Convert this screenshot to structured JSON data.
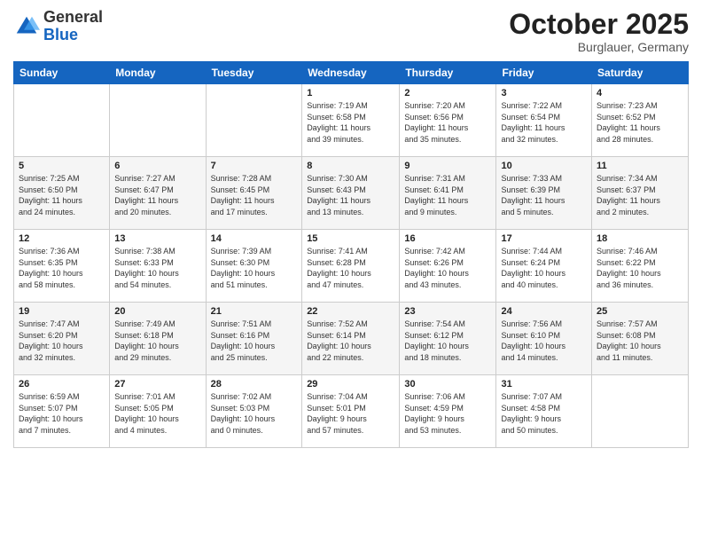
{
  "logo": {
    "general": "General",
    "blue": "Blue"
  },
  "header": {
    "month": "October 2025",
    "location": "Burglauer, Germany"
  },
  "days_of_week": [
    "Sunday",
    "Monday",
    "Tuesday",
    "Wednesday",
    "Thursday",
    "Friday",
    "Saturday"
  ],
  "weeks": [
    [
      {
        "day": "",
        "info": ""
      },
      {
        "day": "",
        "info": ""
      },
      {
        "day": "",
        "info": ""
      },
      {
        "day": "1",
        "info": "Sunrise: 7:19 AM\nSunset: 6:58 PM\nDaylight: 11 hours\nand 39 minutes."
      },
      {
        "day": "2",
        "info": "Sunrise: 7:20 AM\nSunset: 6:56 PM\nDaylight: 11 hours\nand 35 minutes."
      },
      {
        "day": "3",
        "info": "Sunrise: 7:22 AM\nSunset: 6:54 PM\nDaylight: 11 hours\nand 32 minutes."
      },
      {
        "day": "4",
        "info": "Sunrise: 7:23 AM\nSunset: 6:52 PM\nDaylight: 11 hours\nand 28 minutes."
      }
    ],
    [
      {
        "day": "5",
        "info": "Sunrise: 7:25 AM\nSunset: 6:50 PM\nDaylight: 11 hours\nand 24 minutes."
      },
      {
        "day": "6",
        "info": "Sunrise: 7:27 AM\nSunset: 6:47 PM\nDaylight: 11 hours\nand 20 minutes."
      },
      {
        "day": "7",
        "info": "Sunrise: 7:28 AM\nSunset: 6:45 PM\nDaylight: 11 hours\nand 17 minutes."
      },
      {
        "day": "8",
        "info": "Sunrise: 7:30 AM\nSunset: 6:43 PM\nDaylight: 11 hours\nand 13 minutes."
      },
      {
        "day": "9",
        "info": "Sunrise: 7:31 AM\nSunset: 6:41 PM\nDaylight: 11 hours\nand 9 minutes."
      },
      {
        "day": "10",
        "info": "Sunrise: 7:33 AM\nSunset: 6:39 PM\nDaylight: 11 hours\nand 5 minutes."
      },
      {
        "day": "11",
        "info": "Sunrise: 7:34 AM\nSunset: 6:37 PM\nDaylight: 11 hours\nand 2 minutes."
      }
    ],
    [
      {
        "day": "12",
        "info": "Sunrise: 7:36 AM\nSunset: 6:35 PM\nDaylight: 10 hours\nand 58 minutes."
      },
      {
        "day": "13",
        "info": "Sunrise: 7:38 AM\nSunset: 6:33 PM\nDaylight: 10 hours\nand 54 minutes."
      },
      {
        "day": "14",
        "info": "Sunrise: 7:39 AM\nSunset: 6:30 PM\nDaylight: 10 hours\nand 51 minutes."
      },
      {
        "day": "15",
        "info": "Sunrise: 7:41 AM\nSunset: 6:28 PM\nDaylight: 10 hours\nand 47 minutes."
      },
      {
        "day": "16",
        "info": "Sunrise: 7:42 AM\nSunset: 6:26 PM\nDaylight: 10 hours\nand 43 minutes."
      },
      {
        "day": "17",
        "info": "Sunrise: 7:44 AM\nSunset: 6:24 PM\nDaylight: 10 hours\nand 40 minutes."
      },
      {
        "day": "18",
        "info": "Sunrise: 7:46 AM\nSunset: 6:22 PM\nDaylight: 10 hours\nand 36 minutes."
      }
    ],
    [
      {
        "day": "19",
        "info": "Sunrise: 7:47 AM\nSunset: 6:20 PM\nDaylight: 10 hours\nand 32 minutes."
      },
      {
        "day": "20",
        "info": "Sunrise: 7:49 AM\nSunset: 6:18 PM\nDaylight: 10 hours\nand 29 minutes."
      },
      {
        "day": "21",
        "info": "Sunrise: 7:51 AM\nSunset: 6:16 PM\nDaylight: 10 hours\nand 25 minutes."
      },
      {
        "day": "22",
        "info": "Sunrise: 7:52 AM\nSunset: 6:14 PM\nDaylight: 10 hours\nand 22 minutes."
      },
      {
        "day": "23",
        "info": "Sunrise: 7:54 AM\nSunset: 6:12 PM\nDaylight: 10 hours\nand 18 minutes."
      },
      {
        "day": "24",
        "info": "Sunrise: 7:56 AM\nSunset: 6:10 PM\nDaylight: 10 hours\nand 14 minutes."
      },
      {
        "day": "25",
        "info": "Sunrise: 7:57 AM\nSunset: 6:08 PM\nDaylight: 10 hours\nand 11 minutes."
      }
    ],
    [
      {
        "day": "26",
        "info": "Sunrise: 6:59 AM\nSunset: 5:07 PM\nDaylight: 10 hours\nand 7 minutes."
      },
      {
        "day": "27",
        "info": "Sunrise: 7:01 AM\nSunset: 5:05 PM\nDaylight: 10 hours\nand 4 minutes."
      },
      {
        "day": "28",
        "info": "Sunrise: 7:02 AM\nSunset: 5:03 PM\nDaylight: 10 hours\nand 0 minutes."
      },
      {
        "day": "29",
        "info": "Sunrise: 7:04 AM\nSunset: 5:01 PM\nDaylight: 9 hours\nand 57 minutes."
      },
      {
        "day": "30",
        "info": "Sunrise: 7:06 AM\nSunset: 4:59 PM\nDaylight: 9 hours\nand 53 minutes."
      },
      {
        "day": "31",
        "info": "Sunrise: 7:07 AM\nSunset: 4:58 PM\nDaylight: 9 hours\nand 50 minutes."
      },
      {
        "day": "",
        "info": ""
      }
    ]
  ]
}
